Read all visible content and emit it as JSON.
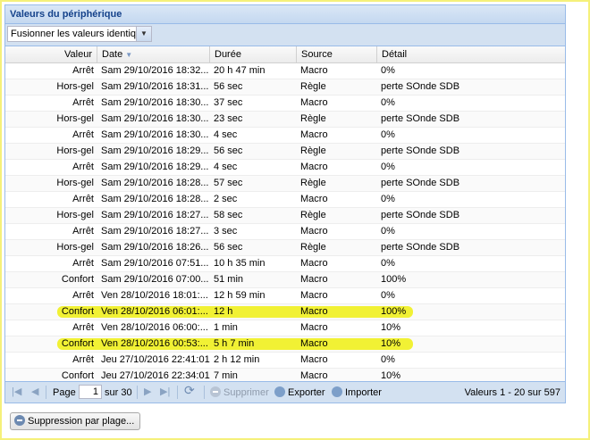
{
  "panel": {
    "title": "Valeurs du périphérique"
  },
  "toolbar": {
    "merge_combo_value": "Fusionner les valeurs identiques"
  },
  "columns": [
    "Valeur",
    "Date",
    "Durée",
    "Source",
    "Détail"
  ],
  "rows": [
    {
      "valeur": "Arrêt",
      "date": "Sam 29/10/2016 18:32...",
      "duree": "20 h 47 min",
      "source": "Macro",
      "detail": "0%"
    },
    {
      "valeur": "Hors-gel",
      "date": "Sam 29/10/2016 18:31...",
      "duree": "56 sec",
      "source": "Règle",
      "detail": "perte SOnde SDB"
    },
    {
      "valeur": "Arrêt",
      "date": "Sam 29/10/2016 18:30...",
      "duree": "37 sec",
      "source": "Macro",
      "detail": "0%"
    },
    {
      "valeur": "Hors-gel",
      "date": "Sam 29/10/2016 18:30...",
      "duree": "23 sec",
      "source": "Règle",
      "detail": "perte SOnde SDB"
    },
    {
      "valeur": "Arrêt",
      "date": "Sam 29/10/2016 18:30...",
      "duree": "4 sec",
      "source": "Macro",
      "detail": "0%"
    },
    {
      "valeur": "Hors-gel",
      "date": "Sam 29/10/2016 18:29...",
      "duree": "56 sec",
      "source": "Règle",
      "detail": "perte SOnde SDB"
    },
    {
      "valeur": "Arrêt",
      "date": "Sam 29/10/2016 18:29...",
      "duree": "4 sec",
      "source": "Macro",
      "detail": "0%"
    },
    {
      "valeur": "Hors-gel",
      "date": "Sam 29/10/2016 18:28...",
      "duree": "57 sec",
      "source": "Règle",
      "detail": "perte SOnde SDB"
    },
    {
      "valeur": "Arrêt",
      "date": "Sam 29/10/2016 18:28...",
      "duree": "2 sec",
      "source": "Macro",
      "detail": "0%"
    },
    {
      "valeur": "Hors-gel",
      "date": "Sam 29/10/2016 18:27...",
      "duree": "58 sec",
      "source": "Règle",
      "detail": "perte SOnde SDB"
    },
    {
      "valeur": "Arrêt",
      "date": "Sam 29/10/2016 18:27...",
      "duree": "3 sec",
      "source": "Macro",
      "detail": "0%"
    },
    {
      "valeur": "Hors-gel",
      "date": "Sam 29/10/2016 18:26...",
      "duree": "56 sec",
      "source": "Règle",
      "detail": "perte SOnde SDB"
    },
    {
      "valeur": "Arrêt",
      "date": "Sam 29/10/2016 07:51...",
      "duree": "10 h 35 min",
      "source": "Macro",
      "detail": "0%"
    },
    {
      "valeur": "Confort",
      "date": "Sam 29/10/2016 07:00...",
      "duree": "51 min",
      "source": "Macro",
      "detail": "100%"
    },
    {
      "valeur": "Arrêt",
      "date": "Ven 28/10/2016 18:01:...",
      "duree": "12 h 59 min",
      "source": "Macro",
      "detail": "0%"
    },
    {
      "valeur": "Confort",
      "date": "Ven 28/10/2016 06:01:...",
      "duree": "12 h",
      "source": "Macro",
      "detail": "100%",
      "highlighted": true
    },
    {
      "valeur": "Arrêt",
      "date": "Ven 28/10/2016 06:00:...",
      "duree": "1 min",
      "source": "Macro",
      "detail": "10%"
    },
    {
      "valeur": "Confort",
      "date": "Ven 28/10/2016 00:53:...",
      "duree": "5 h 7 min",
      "source": "Macro",
      "detail": "10%",
      "highlighted": true
    },
    {
      "valeur": "Arrêt",
      "date": "Jeu 27/10/2016 22:41:01",
      "duree": "2 h 12 min",
      "source": "Macro",
      "detail": "0%"
    },
    {
      "valeur": "Confort",
      "date": "Jeu 27/10/2016 22:34:01",
      "duree": "7 min",
      "source": "Macro",
      "detail": "10%"
    }
  ],
  "pager": {
    "page_label": "Page",
    "page_value": "1",
    "of_label": "sur 30",
    "delete_label": "Supprimer",
    "export_label": "Exporter",
    "import_label": "Importer",
    "summary": "Valeurs 1 - 20 sur 597"
  },
  "range_delete_label": "Suppression par plage...",
  "colors": {
    "header_text": "#15428b",
    "highlight": "#f0f01e",
    "frame": "#f5f07a"
  }
}
